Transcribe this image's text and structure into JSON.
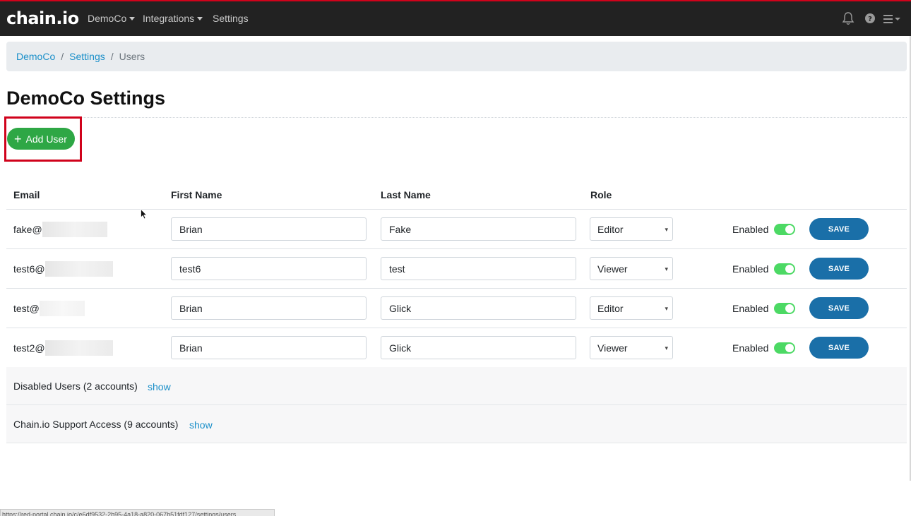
{
  "brand": {
    "logo_text": "chain.io"
  },
  "nav": {
    "items": [
      {
        "label": "DemoCo",
        "has_caret": true
      },
      {
        "label": "Integrations",
        "has_caret": true
      },
      {
        "label": "Settings",
        "has_caret": false
      }
    ],
    "icons": [
      "bell-icon",
      "help-icon",
      "hamburger-menu-icon"
    ]
  },
  "breadcrumb": {
    "items": [
      "DemoCo",
      "Settings"
    ],
    "current": "Users"
  },
  "page": {
    "title": "DemoCo Settings",
    "add_user_label": "Add User"
  },
  "table": {
    "headers": {
      "email": "Email",
      "first_name": "First Name",
      "last_name": "Last Name",
      "role": "Role"
    },
    "rows": [
      {
        "email": "fake@",
        "first_name": "Brian",
        "last_name": "Fake",
        "role": "Editor",
        "status": "Enabled",
        "enabled": true,
        "save_label": "SAVE"
      },
      {
        "email": "test6@",
        "first_name": "test6",
        "last_name": "test",
        "role": "Viewer",
        "status": "Enabled",
        "enabled": true,
        "save_label": "SAVE"
      },
      {
        "email": "test@",
        "first_name": "Brian",
        "last_name": "Glick",
        "role": "Editor",
        "status": "Enabled",
        "enabled": true,
        "save_label": "SAVE"
      },
      {
        "email": "test2@",
        "first_name": "Brian",
        "last_name": "Glick",
        "role": "Viewer",
        "status": "Enabled",
        "enabled": true,
        "save_label": "SAVE"
      }
    ]
  },
  "sections": [
    {
      "label": "Disabled Users (2 accounts)",
      "link": "show"
    },
    {
      "label": "Chain.io Support Access (9 accounts)",
      "link": "show"
    }
  ],
  "status_bar": {
    "url": "https://red-portal.chain.io/c/e6df9532-2b95-4a18-a820-067b51fdf127/settings/users"
  },
  "colors": {
    "topbar": "#222222",
    "accent_red": "#d0021b",
    "link": "#1a8fc9",
    "add_button": "#2ea745",
    "save_button": "#1a6fa8",
    "toggle_on": "#4cd964"
  }
}
